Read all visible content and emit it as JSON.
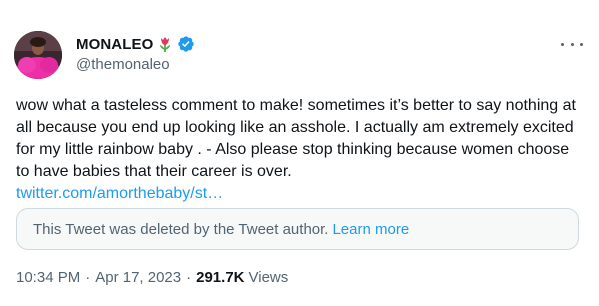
{
  "author": {
    "display_name": "MONALEO",
    "handle": "@themonaleo",
    "flower_emoji": "tulip-emoji",
    "verified": "verified-badge-icon",
    "accent_color": "#1d9bf0"
  },
  "tweet": {
    "text": "wow what a tasteless comment to make! sometimes it’s better to say nothing at all because you end up looking like an asshole. I actually am extremely excited for my little rainbow baby . - Also please stop thinking because women choose to have babies that their career is over.",
    "link": "twitter.com/amorthebaby/st…"
  },
  "quoted": {
    "deleted_message": "This Tweet was deleted by the Tweet author.",
    "learn_more": "Learn more"
  },
  "meta": {
    "time": "10:34 PM",
    "date": "Apr 17, 2023",
    "separator": "·",
    "views_count": "291.7K",
    "views_label": "Views"
  },
  "icons": {
    "more": "more-options-icon"
  }
}
